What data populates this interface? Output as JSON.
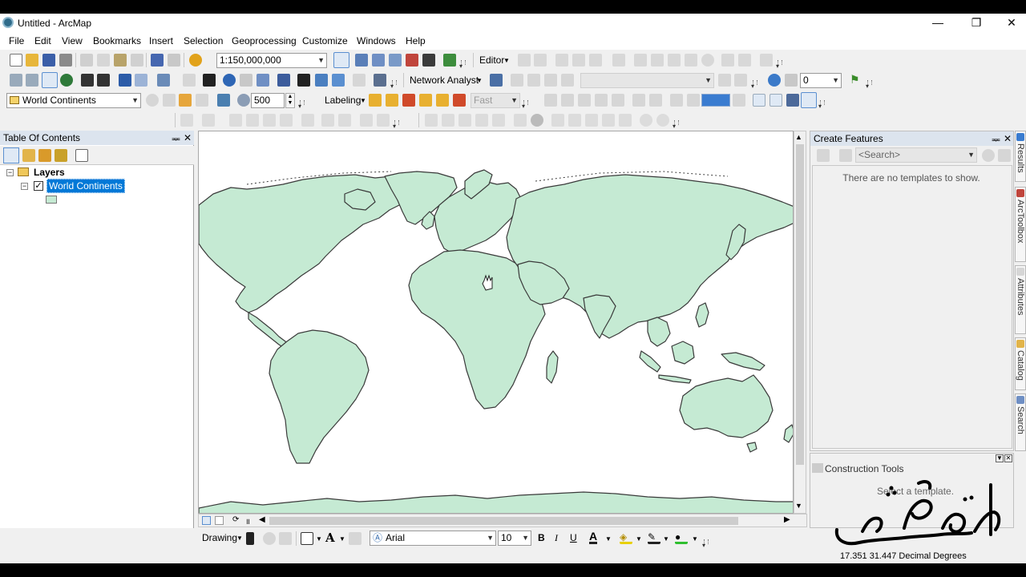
{
  "window": {
    "title": "Untitled - ArcMap",
    "min_glyph": "—",
    "restore_glyph": "❐",
    "close_glyph": "✕"
  },
  "menu": [
    "File",
    "Edit",
    "View",
    "Bookmarks",
    "Insert",
    "Selection",
    "Geoprocessing",
    "Customize",
    "Windows",
    "Help"
  ],
  "toolbar1": {
    "scale_value": "1:150,000,000",
    "editor_label": "Editor"
  },
  "toolbar2": {
    "network_analyst_label": "Network Analyst",
    "zoom_value": "0"
  },
  "toolbar3": {
    "layer_value": "World Continents",
    "reference_scale_value": "500",
    "labeling_label": "Labeling",
    "quality_value": "Fast"
  },
  "toc": {
    "title": "Table Of Contents",
    "pin_glyph": "ᆓ",
    "close_glyph": "✕",
    "group_label": "Layers",
    "layer_label": "World Continents",
    "layer_checked": true,
    "symbol_color": "#c5ead3"
  },
  "create_features": {
    "title": "Create Features",
    "search_placeholder": "<Search>",
    "empty_message": "There are no templates to show."
  },
  "construction_tools": {
    "title": "Construction Tools",
    "message": "Select a template."
  },
  "side_tabs": [
    "Results",
    "ArcToolbox",
    "Attributes",
    "Catalog",
    "Search"
  ],
  "drawing": {
    "drawing_label": "Drawing",
    "font_value": "Arial",
    "font_size": "10",
    "bold": "B",
    "italic": "I",
    "underline": "U",
    "font_color_glyph": "A"
  },
  "status": {
    "coordinates": "17.351  31.447 Decimal Degrees"
  },
  "watermark": "ماهر حسن",
  "colors": {
    "land": "#c5ead3",
    "coast": "#3a3a3a",
    "selection": "#0078d7",
    "panel_header": "#dce4ee"
  }
}
